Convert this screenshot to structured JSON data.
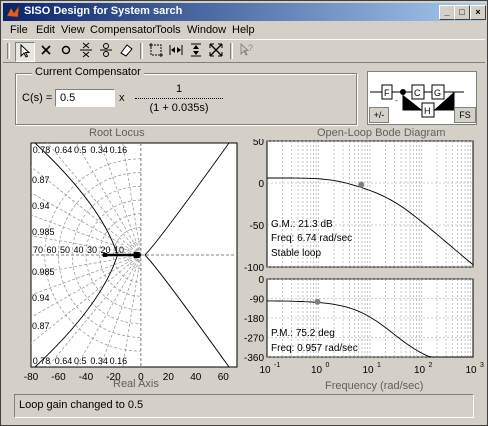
{
  "window": {
    "title": "SISO Design for System sarch"
  },
  "title_buttons": {
    "minimize": "_",
    "maximize": "□",
    "close": "×"
  },
  "menu": [
    "File",
    "Edit",
    "View",
    "Compensator",
    "Tools",
    "Window",
    "Help"
  ],
  "compensator": {
    "group_label": "Current Compensator",
    "cs_label": "C(s) =",
    "gain_value": "0.5",
    "times": "x",
    "numerator": "1",
    "denominator": "(1 + 0.035s)"
  },
  "block_diagram": {
    "blocks": [
      "F",
      "C",
      "G",
      "H"
    ],
    "sign_button": "+/-",
    "fs_button": "FS"
  },
  "root_locus": {
    "title": "Root Locus",
    "xlabel": "Real Axis",
    "x_ticks": [
      "-80",
      "-60",
      "-40",
      "-20",
      "0",
      "20",
      "40",
      "60"
    ],
    "damping_top": [
      "0.78",
      "0.64",
      "0.5",
      "0.34",
      "0.16"
    ],
    "damping_bottom": [
      "0.78",
      "0.64",
      "0.5",
      "0.34",
      "0.16"
    ],
    "left_top": [
      "0.87",
      "0.94",
      "0.985"
    ],
    "left_bottom": [
      "0.985",
      "0.94",
      "0.87"
    ],
    "freq_labels": [
      "70",
      "60",
      "50",
      "40",
      "30",
      "20",
      "10"
    ]
  },
  "bode": {
    "title": "Open-Loop Bode Diagram",
    "xlabel": "Frequency (rad/sec)",
    "mag_ticks": [
      "50",
      "0",
      "-50",
      "-100"
    ],
    "phase_ticks": [
      "0",
      "-90",
      "-180",
      "-270",
      "-360"
    ],
    "x_ticks": [
      "10",
      "10",
      "10",
      "10",
      "10"
    ],
    "x_exponents": [
      "-1",
      "0",
      "1",
      "2",
      "3"
    ],
    "gm": "G.M.: 21.3 dB",
    "gm_freq": "Freq: 6.74 rad/sec",
    "stability": "Stable loop",
    "pm": "P.M.: 75.2 deg",
    "pm_freq": "Freq: 0.957 rad/sec"
  },
  "status": "Loop gain changed to 0.5"
}
